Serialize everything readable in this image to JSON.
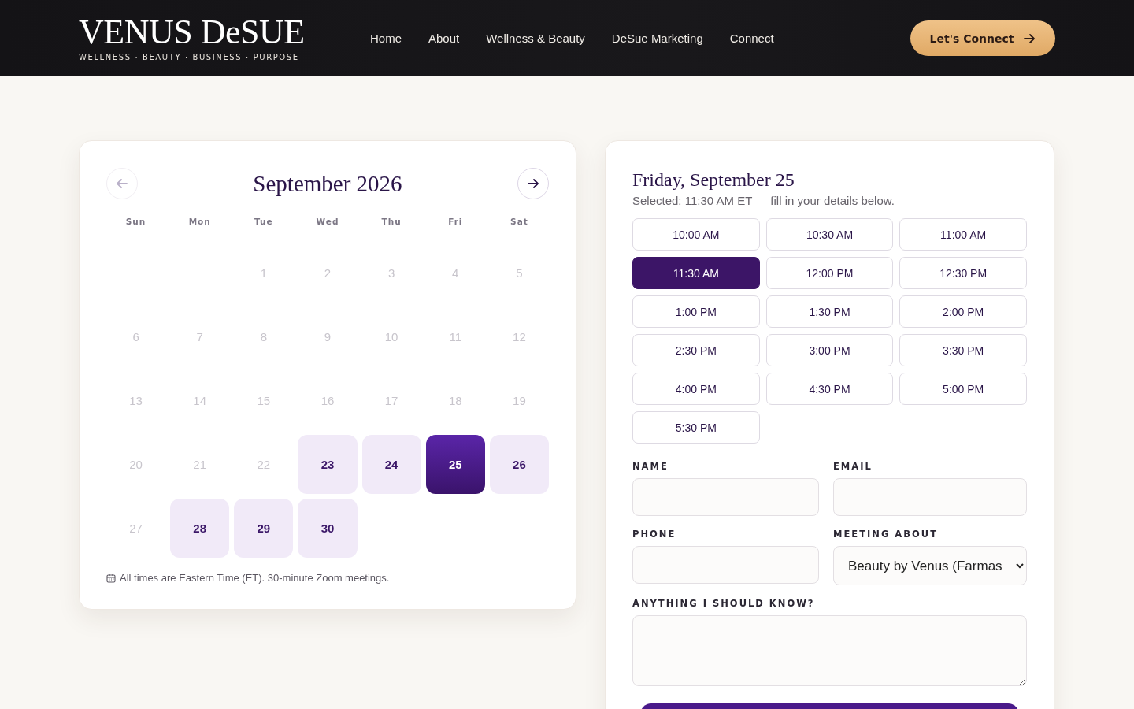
{
  "header": {
    "logo": "VENUS DeSUE",
    "tagline": "WELLNESS · BEAUTY · BUSINESS · PURPOSE",
    "nav": [
      {
        "label": "Home"
      },
      {
        "label": "About"
      },
      {
        "label": "Wellness & Beauty"
      },
      {
        "label": "DeSue Marketing"
      },
      {
        "label": "Connect"
      }
    ],
    "cta": "Let's Connect"
  },
  "calendar": {
    "month": "September 2026",
    "prev_disabled": true,
    "next_disabled": false,
    "weekdays": [
      "Sun",
      "Mon",
      "Tue",
      "Wed",
      "Thu",
      "Fri",
      "Sat"
    ],
    "weeks": [
      [
        {
          "kind": "empty"
        },
        {
          "kind": "empty"
        },
        {
          "kind": "day",
          "label": "1",
          "available": false,
          "selected": false
        },
        {
          "kind": "day",
          "label": "2",
          "available": false,
          "selected": false
        },
        {
          "kind": "day",
          "label": "3",
          "available": false,
          "selected": false
        },
        {
          "kind": "day",
          "label": "4",
          "available": false,
          "selected": false
        },
        {
          "kind": "day",
          "label": "5",
          "available": false,
          "selected": false
        }
      ],
      [
        {
          "kind": "day",
          "label": "6",
          "available": false,
          "selected": false
        },
        {
          "kind": "day",
          "label": "7",
          "available": false,
          "selected": false
        },
        {
          "kind": "day",
          "label": "8",
          "available": false,
          "selected": false
        },
        {
          "kind": "day",
          "label": "9",
          "available": false,
          "selected": false
        },
        {
          "kind": "day",
          "label": "10",
          "available": false,
          "selected": false
        },
        {
          "kind": "day",
          "label": "11",
          "available": false,
          "selected": false
        },
        {
          "kind": "day",
          "label": "12",
          "available": false,
          "selected": false
        }
      ],
      [
        {
          "kind": "day",
          "label": "13",
          "available": false,
          "selected": false
        },
        {
          "kind": "day",
          "label": "14",
          "available": false,
          "selected": false
        },
        {
          "kind": "day",
          "label": "15",
          "available": false,
          "selected": false
        },
        {
          "kind": "day",
          "label": "16",
          "available": false,
          "selected": false
        },
        {
          "kind": "day",
          "label": "17",
          "available": false,
          "selected": false
        },
        {
          "kind": "day",
          "label": "18",
          "available": false,
          "selected": false
        },
        {
          "kind": "day",
          "label": "19",
          "available": false,
          "selected": false
        }
      ],
      [
        {
          "kind": "day",
          "label": "20",
          "available": false,
          "selected": false
        },
        {
          "kind": "day",
          "label": "21",
          "available": false,
          "selected": false
        },
        {
          "kind": "day",
          "label": "22",
          "available": false,
          "selected": false
        },
        {
          "kind": "day",
          "label": "23",
          "available": true,
          "selected": false
        },
        {
          "kind": "day",
          "label": "24",
          "available": true,
          "selected": false
        },
        {
          "kind": "day",
          "label": "25",
          "available": true,
          "selected": true
        },
        {
          "kind": "day",
          "label": "26",
          "available": true,
          "selected": false
        }
      ],
      [
        {
          "kind": "day",
          "label": "27",
          "available": false,
          "selected": false
        },
        {
          "kind": "day",
          "label": "28",
          "available": true,
          "selected": false
        },
        {
          "kind": "day",
          "label": "29",
          "available": true,
          "selected": false
        },
        {
          "kind": "day",
          "label": "30",
          "available": true,
          "selected": false
        }
      ]
    ],
    "note": "All times are Eastern Time (ET). 30-minute Zoom meetings."
  },
  "booking": {
    "title": "Friday, September 25",
    "subtitle": "Selected: 11:30 AM ET — fill in your details below.",
    "slots": [
      {
        "label": "10:00 AM",
        "selected": false
      },
      {
        "label": "10:30 AM",
        "selected": false
      },
      {
        "label": "11:00 AM",
        "selected": false
      },
      {
        "label": "11:30 AM",
        "selected": true
      },
      {
        "label": "12:00 PM",
        "selected": false
      },
      {
        "label": "12:30 PM",
        "selected": false
      },
      {
        "label": "1:00 PM",
        "selected": false
      },
      {
        "label": "1:30 PM",
        "selected": false
      },
      {
        "label": "2:00 PM",
        "selected": false
      },
      {
        "label": "2:30 PM",
        "selected": false
      },
      {
        "label": "3:00 PM",
        "selected": false
      },
      {
        "label": "3:30 PM",
        "selected": false
      },
      {
        "label": "4:00 PM",
        "selected": false
      },
      {
        "label": "4:30 PM",
        "selected": false
      },
      {
        "label": "5:00 PM",
        "selected": false
      },
      {
        "label": "5:30 PM",
        "selected": false
      }
    ],
    "fields": [
      {
        "kind": "text",
        "label": "NAME"
      },
      {
        "kind": "text",
        "label": "EMAIL"
      },
      {
        "kind": "text",
        "label": "PHONE"
      },
      {
        "kind": "select",
        "label": "MEETING ABOUT",
        "value": "Beauty by Venus (Farmas"
      },
      {
        "kind": "textarea",
        "label": "ANYTHING I SHOULD KNOW?"
      }
    ]
  }
}
